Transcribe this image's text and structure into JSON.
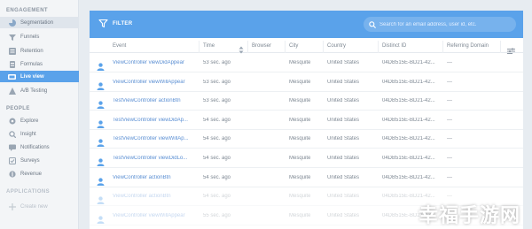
{
  "sidebar": {
    "engagement_title": "ENGAGEMENT",
    "engagement_items": [
      {
        "label": "Segmentation",
        "icon": "segmentation-icon"
      },
      {
        "label": "Funnels",
        "icon": "funnel-icon"
      },
      {
        "label": "Retention",
        "icon": "retention-icon"
      },
      {
        "label": "Formulas",
        "icon": "formula-icon"
      },
      {
        "label": "Live view",
        "icon": "live-view-icon"
      },
      {
        "label": "A/B Testing",
        "icon": "ab-testing-icon"
      }
    ],
    "people_title": "PEOPLE",
    "people_items": [
      {
        "label": "Explore",
        "icon": "explore-icon"
      },
      {
        "label": "Insight",
        "icon": "insight-icon"
      },
      {
        "label": "Notifications",
        "icon": "notifications-icon"
      },
      {
        "label": "Surveys",
        "icon": "surveys-icon"
      },
      {
        "label": "Revenue",
        "icon": "revenue-icon"
      }
    ],
    "applications_title": "APPLICATIONS",
    "create_new_label": "Create new"
  },
  "toolbar": {
    "filter_label": "FILTER",
    "search_placeholder": "Search for an email address, user id, etc."
  },
  "table": {
    "columns": [
      "Event",
      "Time",
      "Browser",
      "City",
      "Country",
      "Distinct ID",
      "Referring Domain"
    ],
    "rows": [
      {
        "event": "ViewController viewDidAppear",
        "time": "53 sec. ago",
        "browser": "",
        "city": "Mesquite",
        "country": "United States",
        "distinct_id": "04DB515E-BD21-42...",
        "domain": "---"
      },
      {
        "event": "ViewController viewWillAppear",
        "time": "53 sec. ago",
        "browser": "",
        "city": "Mesquite",
        "country": "United States",
        "distinct_id": "04DB515E-BD21-42...",
        "domain": "---"
      },
      {
        "event": "TestViewController actionBtn",
        "time": "53 sec. ago",
        "browser": "",
        "city": "Mesquite",
        "country": "United States",
        "distinct_id": "04DB515E-BD21-42...",
        "domain": "---"
      },
      {
        "event": "TestViewController viewDidAp...",
        "time": "54 sec. ago",
        "browser": "",
        "city": "Mesquite",
        "country": "United States",
        "distinct_id": "04DB515E-BD21-42...",
        "domain": "---"
      },
      {
        "event": "TestViewController viewWillAp...",
        "time": "54 sec. ago",
        "browser": "",
        "city": "Mesquite",
        "country": "United States",
        "distinct_id": "04DB515E-BD21-42...",
        "domain": "---"
      },
      {
        "event": "TestViewController viewDidLo...",
        "time": "54 sec. ago",
        "browser": "",
        "city": "Mesquite",
        "country": "United States",
        "distinct_id": "04DB515E-BD21-42...",
        "domain": "---"
      },
      {
        "event": "ViewController actionBtn",
        "time": "54 sec. ago",
        "browser": "",
        "city": "Mesquite",
        "country": "United States",
        "distinct_id": "04DB515E-BD21-42...",
        "domain": "---"
      },
      {
        "event": "ViewController actionBtn",
        "time": "54 sec. ago",
        "browser": "",
        "city": "Mesquite",
        "country": "United States",
        "distinct_id": "04DB515E-BD21-42...",
        "domain": "---"
      },
      {
        "event": "ViewController viewWillAppear",
        "time": "55 sec. ago",
        "browser": "",
        "city": "Mesquite",
        "country": "United States",
        "distinct_id": "04DB515E-BD21-42...",
        "domain": "---"
      }
    ]
  },
  "watermark": "幸福手游网",
  "colors": {
    "accent": "#5aa2ea",
    "event_text": "#5b8fd3",
    "sidebar_bg": "#f3f5f7"
  }
}
